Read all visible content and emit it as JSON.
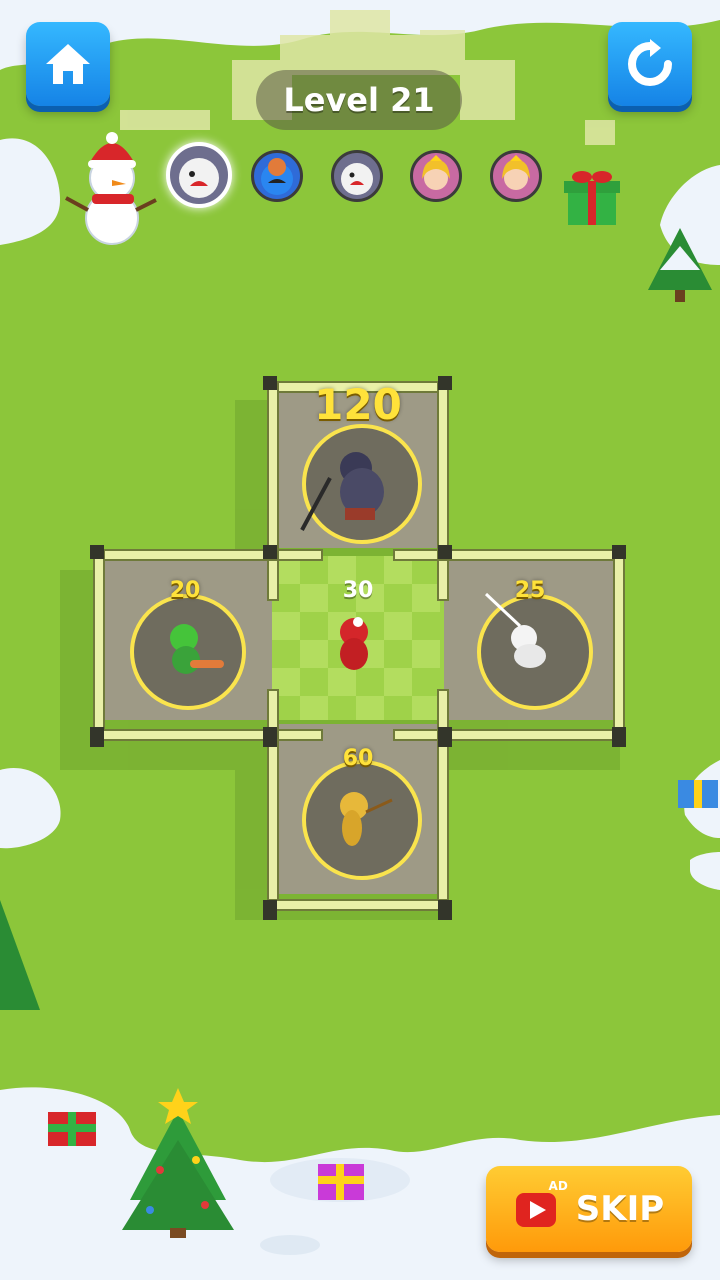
{
  "header": {
    "level_label": "Level 21",
    "home_icon": "home-icon",
    "restart_icon": "restart-icon"
  },
  "progress_track": {
    "start_icon": "snowman-icon",
    "end_icon": "gift-icon",
    "opponents": [
      {
        "name": "polar-bear",
        "state": "current"
      },
      {
        "name": "blue-monster",
        "state": "upcoming"
      },
      {
        "name": "polar-bear",
        "state": "upcoming"
      },
      {
        "name": "princess",
        "state": "upcoming"
      },
      {
        "name": "princess",
        "state": "upcoming"
      }
    ]
  },
  "arena": {
    "rooms": [
      {
        "id": "top",
        "power": "120",
        "enemy": "dark-ninja"
      },
      {
        "id": "left",
        "power": "20",
        "enemy": "green-goblin"
      },
      {
        "id": "center",
        "power": "30",
        "enemy": "santa-player"
      },
      {
        "id": "right",
        "power": "25",
        "enemy": "white-skeleton"
      },
      {
        "id": "bottom",
        "power": "60",
        "enemy": "golden-warrior"
      }
    ]
  },
  "footer": {
    "skip_label": "SKIP",
    "ad_tag": "AD",
    "ad_icon": "video-ad-icon"
  },
  "colors": {
    "grass": "#8cc63a",
    "snow": "#eef4fb",
    "button_blue": "#1e9bf5",
    "button_orange": "#ffb01f",
    "power_yellow": "#ffe23a"
  }
}
